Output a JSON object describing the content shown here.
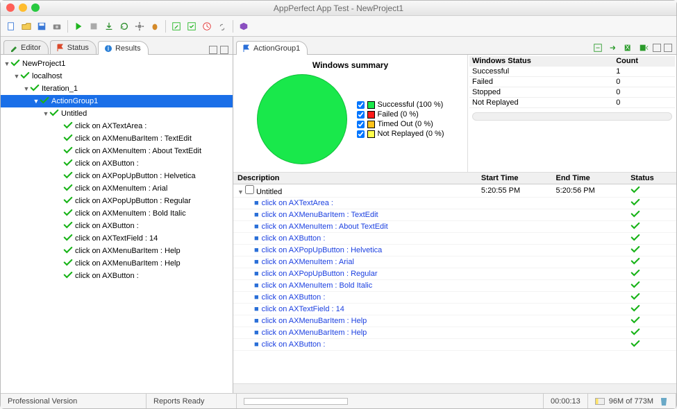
{
  "window": {
    "title": "AppPerfect App Test - NewProject1"
  },
  "tabs_left": [
    {
      "icon": "pencil",
      "label": "Editor",
      "active": false
    },
    {
      "icon": "flag",
      "label": "Status",
      "active": false
    },
    {
      "icon": "info",
      "label": "Results",
      "active": true
    }
  ],
  "tabs_right": [
    {
      "icon": "flag",
      "label": "ActionGroup1",
      "active": true
    }
  ],
  "tree": [
    {
      "level": 0,
      "label": "NewProject1"
    },
    {
      "level": 1,
      "label": "localhost"
    },
    {
      "level": 2,
      "label": "Iteration_1"
    },
    {
      "level": 3,
      "label": "ActionGroup1",
      "selected": true
    },
    {
      "level": 4,
      "label": "Untitled"
    },
    {
      "level": 5,
      "label": "click on AXTextArea :"
    },
    {
      "level": 5,
      "label": "click on AXMenuBarItem : TextEdit"
    },
    {
      "level": 5,
      "label": "click on AXMenuItem : About TextEdit"
    },
    {
      "level": 5,
      "label": "click on AXButton :"
    },
    {
      "level": 5,
      "label": "click on AXPopUpButton : Helvetica"
    },
    {
      "level": 5,
      "label": "click on AXMenuItem : Arial"
    },
    {
      "level": 5,
      "label": "click on AXPopUpButton : Regular"
    },
    {
      "level": 5,
      "label": "click on AXMenuItem : Bold Italic"
    },
    {
      "level": 5,
      "label": "click on AXButton :"
    },
    {
      "level": 5,
      "label": "click on AXTextField : 14"
    },
    {
      "level": 5,
      "label": "click on AXMenuBarItem : Help"
    },
    {
      "level": 5,
      "label": "click on AXMenuBarItem : Help"
    },
    {
      "level": 5,
      "label": "click on AXButton :"
    }
  ],
  "chart_data": {
    "type": "pie",
    "title": "Windows summary",
    "series": [
      {
        "name": "Successful",
        "value": 1,
        "percent": 100,
        "color": "#19e84b"
      },
      {
        "name": "Failed",
        "value": 0,
        "percent": 0,
        "color": "#ff1a1a"
      },
      {
        "name": "Timed Out",
        "value": 0,
        "percent": 0,
        "color": "#ffc21a"
      },
      {
        "name": "Not Replayed",
        "value": 0,
        "percent": 0,
        "color": "#ffff4d"
      }
    ],
    "legend_labels": [
      "Successful (100 %)",
      "Failed (0 %)",
      "Timed Out (0 %)",
      "Not Replayed (0 %)"
    ]
  },
  "status_table": {
    "headers": [
      "Windows Status",
      "Count"
    ],
    "rows": [
      [
        "Successful",
        "1"
      ],
      [
        "Failed",
        "0"
      ],
      [
        "Stopped",
        "0"
      ],
      [
        "Not Replayed",
        "0"
      ]
    ]
  },
  "detail_headers": [
    "Description",
    "Start Time",
    "End Time",
    "Status"
  ],
  "detail_parent": {
    "label": "Untitled",
    "start": "5:20:55 PM",
    "end": "5:20:56 PM"
  },
  "detail_rows": [
    "click on AXTextArea :",
    "click on AXMenuBarItem : TextEdit",
    "click on AXMenuItem : About TextEdit",
    "click on AXButton :",
    "click on AXPopUpButton : Helvetica",
    "click on AXMenuItem : Arial",
    "click on AXPopUpButton : Regular",
    "click on AXMenuItem : Bold Italic",
    "click on AXButton :",
    "click on AXTextField : 14",
    "click on AXMenuBarItem : Help",
    "click on AXMenuBarItem : Help",
    "click on AXButton :"
  ],
  "statusbar": {
    "edition": "Professional Version",
    "reports": "Reports Ready",
    "elapsed": "00:00:13",
    "memory": "96M of 773M"
  }
}
